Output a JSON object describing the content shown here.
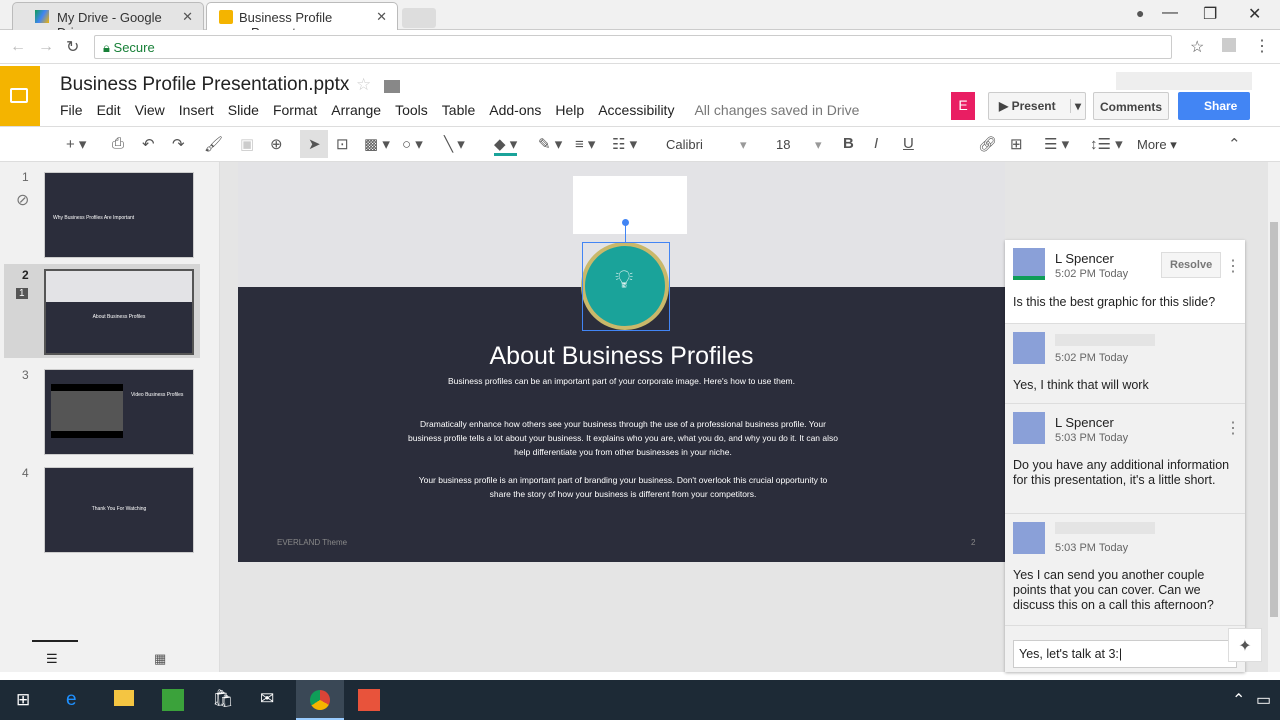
{
  "browser": {
    "tabs": [
      {
        "label": "My Drive - Google Drive"
      },
      {
        "label": "Business Profile Presenta"
      }
    ],
    "secure_label": "Secure"
  },
  "doc": {
    "title": "Business Profile Presentation.pptx",
    "save_status": "All changes saved in Drive",
    "menu": [
      "File",
      "Edit",
      "View",
      "Insert",
      "Slide",
      "Format",
      "Arrange",
      "Tools",
      "Table",
      "Add-ons",
      "Help",
      "Accessibility"
    ],
    "user_initial": "E",
    "present_label": "Present",
    "comments_label": "Comments",
    "share_label": "Share"
  },
  "toolbar": {
    "font": "Calibri",
    "size": "18",
    "bold": "B",
    "italic": "I",
    "underline": "U",
    "more_label": "More"
  },
  "slides": [
    {
      "num": "1",
      "text": "Why Business Profiles Are Important"
    },
    {
      "num": "2",
      "text": "About Business Profiles",
      "comment_count": "1"
    },
    {
      "num": "3",
      "text": "Video Business Profiles"
    },
    {
      "num": "4",
      "text": "Thank You For Watching"
    }
  ],
  "slide": {
    "title": "About Business Profiles",
    "subtitle": "Business profiles can be an important part of your corporate image. Here's how to use them.",
    "para1": "Dramatically enhance how others see your business through the use of a professional business profile. Your business profile tells a lot about your business. It explains who you are, what you do, and why you do it. It can also help differentiate you from other businesses in your niche.",
    "para2": "Your business profile is an important part of branding your business. Don't overlook this crucial opportunity to share the story of how your business is different from your competitors.",
    "footer": "EVERLAND Theme",
    "page": "2"
  },
  "comments": {
    "resolve_label": "Resolve",
    "items": [
      {
        "name": "L Spencer",
        "time": "5:02 PM Today",
        "text": "Is this the best graphic for this slide?"
      },
      {
        "name": "",
        "time": "5:02 PM Today",
        "text": "Yes, I think that will work"
      },
      {
        "name": "L Spencer",
        "time": "5:03 PM Today",
        "text": "Do you have any additional information for this presentation, it's a little short."
      },
      {
        "name": "",
        "time": "5:03 PM Today",
        "text": "Yes I can send you another couple points that you can cover. Can we discuss this on a call this afternoon?"
      }
    ],
    "reply_value": "Yes, let's talk at 3:"
  },
  "colors": {
    "accent": "#f4b400",
    "share": "#4285f4",
    "slide_bg": "#2b2d3b",
    "teal": "#1aa39a",
    "user": "#e91e63"
  }
}
